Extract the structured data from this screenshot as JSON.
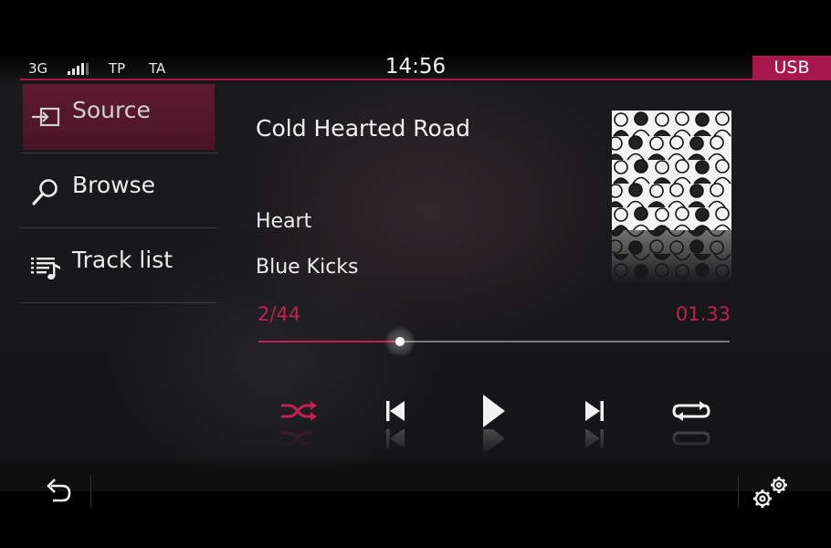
{
  "status": {
    "network": "3G",
    "tp": "TP",
    "ta": "TA",
    "clock": "14:56",
    "source_tab": "USB"
  },
  "menu": [
    {
      "label": "Source",
      "icon": "source-input-icon",
      "active": true
    },
    {
      "label": "Browse",
      "icon": "search-icon",
      "active": false
    },
    {
      "label": "Track list",
      "icon": "track-list-icon",
      "active": false
    }
  ],
  "now_playing": {
    "title": "Cold Hearted Road",
    "artist": "Heart",
    "album": "Blue Kicks",
    "track_position": "2/44",
    "elapsed": "01.33",
    "progress_fraction": 0.3
  },
  "controls": {
    "shuffle": {
      "icon": "shuffle-icon",
      "active": true
    },
    "previous": {
      "icon": "skip-previous-icon"
    },
    "play": {
      "icon": "play-icon"
    },
    "next": {
      "icon": "skip-next-icon"
    },
    "repeat": {
      "icon": "repeat-icon",
      "active": false
    }
  },
  "bottom": {
    "back": {
      "icon": "back-arrow-icon"
    },
    "settings": {
      "icon": "gears-icon"
    }
  },
  "colors": {
    "accent": "#a8174a",
    "accent_text": "#c21f55",
    "menu_active": "#5e1a30"
  }
}
